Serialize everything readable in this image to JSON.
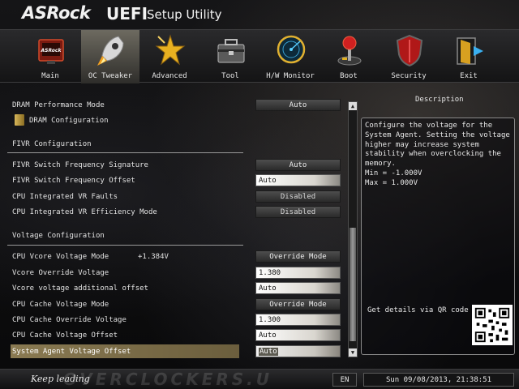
{
  "header": {
    "brand": "ASRock",
    "product": "UEFI",
    "subtitle": "Setup Utility"
  },
  "nav": {
    "tabs": [
      {
        "label": "Main",
        "icon": "main-icon"
      },
      {
        "label": "OC Tweaker",
        "icon": "rocket-icon",
        "active": true
      },
      {
        "label": "Advanced",
        "icon": "star-icon"
      },
      {
        "label": "Tool",
        "icon": "toolbox-icon"
      },
      {
        "label": "H/W Monitor",
        "icon": "radar-icon"
      },
      {
        "label": "Boot",
        "icon": "joystick-icon"
      },
      {
        "label": "Security",
        "icon": "shield-icon"
      },
      {
        "label": "Exit",
        "icon": "exit-door-icon"
      }
    ]
  },
  "settings": {
    "dram_performance_mode": {
      "label": "DRAM Performance Mode",
      "value": "Auto"
    },
    "dram_configuration": {
      "label": "DRAM Configuration"
    },
    "fivr_section": "FIVR Configuration",
    "fivr_freq_signature": {
      "label": "FIVR Switch Frequency Signature",
      "value": "Auto"
    },
    "fivr_freq_offset": {
      "label": "FIVR Switch Frequency Offset",
      "value": "Auto"
    },
    "cpu_vr_faults": {
      "label": "CPU Integrated VR Faults",
      "value": "Disabled"
    },
    "cpu_vr_efficiency": {
      "label": "CPU Integrated VR Efficiency Mode",
      "value": "Disabled"
    },
    "voltage_section": "Voltage Configuration",
    "vcore_mode": {
      "label": "CPU Vcore Voltage Mode",
      "readout": "+1.384V",
      "value": "Override Mode"
    },
    "vcore_override": {
      "label": "Vcore Override Voltage",
      "value": "1.380"
    },
    "vcore_offset": {
      "label": "Vcore voltage additional offset",
      "value": "Auto"
    },
    "cache_mode": {
      "label": "CPU Cache Voltage Mode",
      "value": "Override Mode"
    },
    "cache_override": {
      "label": "CPU Cache Override Voltage",
      "value": "1.300"
    },
    "cache_offset": {
      "label": "CPU Cache Voltage Offset",
      "value": "Auto"
    },
    "sa_offset": {
      "label": "System Agent Voltage Offset",
      "value": "Auto"
    }
  },
  "description": {
    "title": "Description",
    "text": "Configure the voltage for the\nSystem Agent. Setting the voltage\nhigher may increase system\nstability when overclocking the\nmemory.\nMin = -1.000V\nMax = 1.000V",
    "qr_label": "Get details via QR code"
  },
  "footer": {
    "slogan": "Keep leading",
    "watermark": "OVERCLOCKERS.U",
    "language": "EN",
    "datetime": "Sun 09/08/2013, 21:38:51"
  },
  "scrollbar": {
    "up": "▲",
    "down": "▼"
  }
}
